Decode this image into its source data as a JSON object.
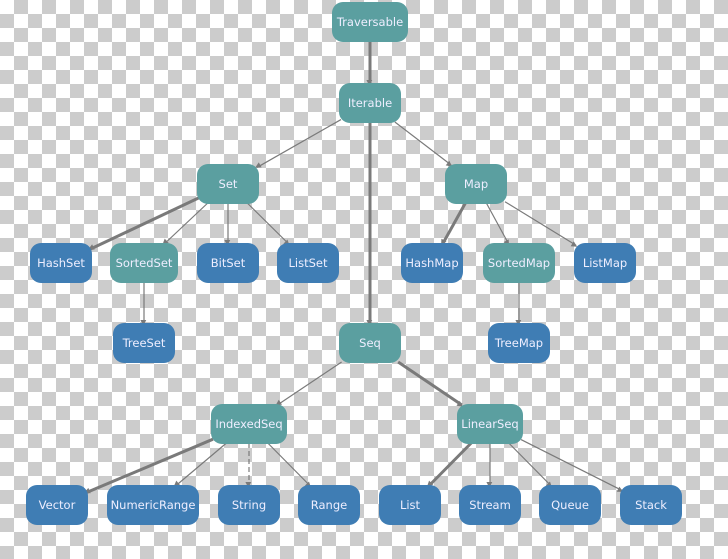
{
  "colors": {
    "trait": "#5b9fa0",
    "class": "#3f7db4",
    "edge": "#7a7a7a"
  },
  "nodes": [
    {
      "id": "Traversable",
      "label": "Traversable",
      "kind": "trait"
    },
    {
      "id": "Iterable",
      "label": "Iterable",
      "kind": "trait"
    },
    {
      "id": "Set",
      "label": "Set",
      "kind": "trait"
    },
    {
      "id": "Map",
      "label": "Map",
      "kind": "trait"
    },
    {
      "id": "HashSet",
      "label": "HashSet",
      "kind": "class"
    },
    {
      "id": "SortedSet",
      "label": "SortedSet",
      "kind": "trait"
    },
    {
      "id": "BitSet",
      "label": "BitSet",
      "kind": "class"
    },
    {
      "id": "ListSet",
      "label": "ListSet",
      "kind": "class"
    },
    {
      "id": "HashMap",
      "label": "HashMap",
      "kind": "class"
    },
    {
      "id": "SortedMap",
      "label": "SortedMap",
      "kind": "trait"
    },
    {
      "id": "ListMap",
      "label": "ListMap",
      "kind": "class"
    },
    {
      "id": "TreeSet",
      "label": "TreeSet",
      "kind": "class"
    },
    {
      "id": "TreeMap",
      "label": "TreeMap",
      "kind": "class"
    },
    {
      "id": "Seq",
      "label": "Seq",
      "kind": "trait"
    },
    {
      "id": "IndexedSeq",
      "label": "IndexedSeq",
      "kind": "trait"
    },
    {
      "id": "LinearSeq",
      "label": "LinearSeq",
      "kind": "trait"
    },
    {
      "id": "Vector",
      "label": "Vector",
      "kind": "class"
    },
    {
      "id": "NumericRange",
      "label": "NumericRange",
      "kind": "class"
    },
    {
      "id": "String",
      "label": "String",
      "kind": "class"
    },
    {
      "id": "Range",
      "label": "Range",
      "kind": "class"
    },
    {
      "id": "List",
      "label": "List",
      "kind": "class"
    },
    {
      "id": "Stream",
      "label": "Stream",
      "kind": "class"
    },
    {
      "id": "Queue",
      "label": "Queue",
      "kind": "class"
    },
    {
      "id": "Stack",
      "label": "Stack",
      "kind": "class"
    }
  ],
  "edges": [
    {
      "from": "Traversable",
      "to": "Iterable",
      "style": "thick"
    },
    {
      "from": "Iterable",
      "to": "Set",
      "style": "thin"
    },
    {
      "from": "Iterable",
      "to": "Map",
      "style": "thin"
    },
    {
      "from": "Iterable",
      "to": "Seq",
      "style": "thick"
    },
    {
      "from": "Set",
      "to": "HashSet",
      "style": "thick"
    },
    {
      "from": "Set",
      "to": "SortedSet",
      "style": "thin"
    },
    {
      "from": "Set",
      "to": "BitSet",
      "style": "thin"
    },
    {
      "from": "Set",
      "to": "ListSet",
      "style": "thin"
    },
    {
      "from": "SortedSet",
      "to": "TreeSet",
      "style": "thin"
    },
    {
      "from": "Map",
      "to": "HashMap",
      "style": "thick"
    },
    {
      "from": "Map",
      "to": "SortedMap",
      "style": "thin"
    },
    {
      "from": "Map",
      "to": "ListMap",
      "style": "thin"
    },
    {
      "from": "SortedMap",
      "to": "TreeMap",
      "style": "thin"
    },
    {
      "from": "Seq",
      "to": "IndexedSeq",
      "style": "thin"
    },
    {
      "from": "Seq",
      "to": "LinearSeq",
      "style": "thick"
    },
    {
      "from": "IndexedSeq",
      "to": "Vector",
      "style": "thick"
    },
    {
      "from": "IndexedSeq",
      "to": "NumericRange",
      "style": "thin"
    },
    {
      "from": "IndexedSeq",
      "to": "String",
      "style": "dashed"
    },
    {
      "from": "IndexedSeq",
      "to": "Range",
      "style": "thin"
    },
    {
      "from": "LinearSeq",
      "to": "List",
      "style": "thick"
    },
    {
      "from": "LinearSeq",
      "to": "Stream",
      "style": "thin"
    },
    {
      "from": "LinearSeq",
      "to": "Queue",
      "style": "thin"
    },
    {
      "from": "LinearSeq",
      "to": "Stack",
      "style": "thin"
    }
  ]
}
